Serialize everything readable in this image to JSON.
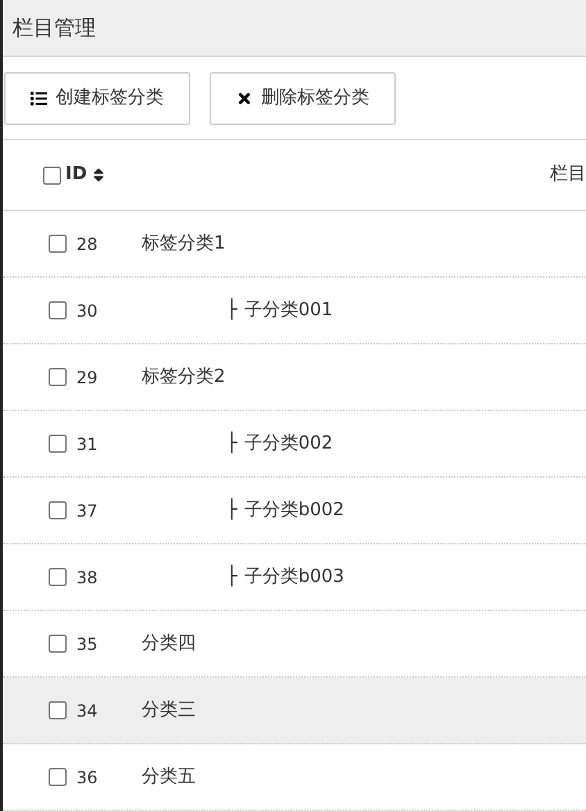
{
  "title": "栏目管理",
  "toolbar": [
    {
      "kind": "list",
      "label": "创建标签分类"
    },
    {
      "kind": "delete",
      "label": "删除标签分类"
    }
  ],
  "table": {
    "header": {
      "checked": false,
      "id_label": "ID",
      "column_2": "栏目"
    },
    "rows": [
      {
        "id": "28",
        "name": "标签分类1",
        "checked": false,
        "hovered": false,
        "children": [
          {
            "id": "30",
            "prefix": "├",
            "name": "子分类001",
            "checked": false,
            "hovered": false
          }
        ]
      },
      {
        "id": "29",
        "name": "标签分类2",
        "checked": false,
        "hovered": false,
        "children": [
          {
            "id": "31",
            "prefix": "├",
            "name": "子分类002",
            "checked": false,
            "hovered": false
          },
          {
            "id": "37",
            "prefix": "├",
            "name": "子分类b002",
            "checked": false,
            "hovered": false
          },
          {
            "id": "38",
            "prefix": "├",
            "name": "子分类b003",
            "checked": false,
            "hovered": false
          }
        ]
      },
      {
        "id": "35",
        "name": "分类四",
        "checked": false,
        "hovered": false
      },
      {
        "id": "34",
        "name": "分类三",
        "checked": false,
        "hovered": true
      },
      {
        "id": "36",
        "name": "分类五",
        "checked": false,
        "hovered": false
      }
    ]
  }
}
